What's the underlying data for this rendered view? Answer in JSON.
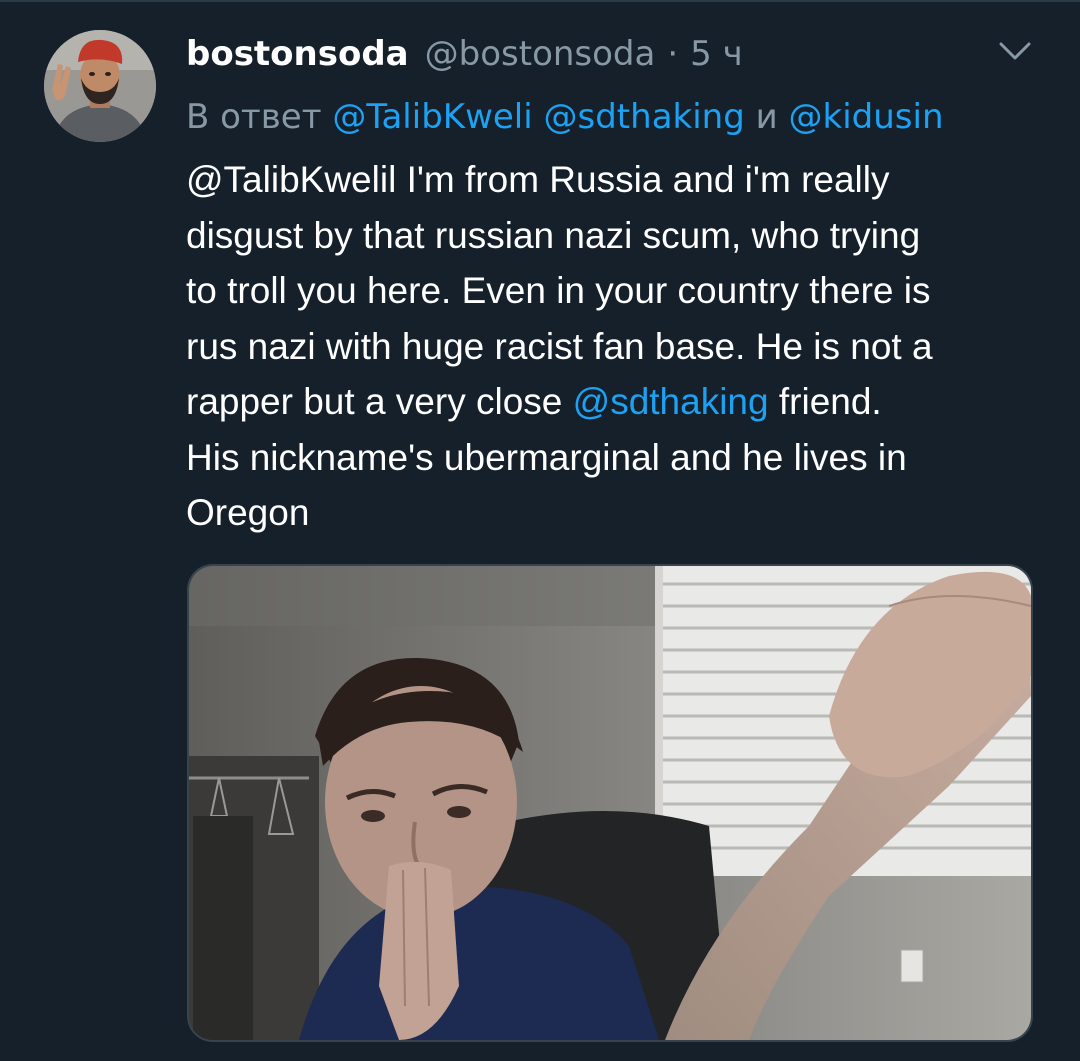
{
  "tweet": {
    "author": {
      "display_name": "bostonsoda",
      "handle": "@bostonsoda"
    },
    "separator": "·",
    "timestamp": "5 ч",
    "reply": {
      "prefix": "В ответ",
      "mention_1": "@TalibKweli",
      "mention_2": "@sdthaking",
      "conjunction": "и",
      "mention_3": "@kidusin"
    },
    "text": {
      "line_1": "@TalibKwelil I'm from Russia and i'm really",
      "line_2": "disgust by that russian nazi scum, who trying",
      "line_3": "to troll you here. Even in your country there is",
      "line_4": "rus nazi with huge racist fan base. He is not a",
      "line_5_before": "rapper but a very close ",
      "line_5_mention": "@sdthaking",
      "line_5_after": " friend.",
      "line_6": "His nickname's ubermarginal and he lives in",
      "line_7": "Oregon"
    }
  },
  "colors": {
    "background": "#15202b",
    "text_primary": "#ffffff",
    "text_secondary": "#8899a6",
    "link": "#1da1f2"
  },
  "icons": {
    "menu": "chevron-down-icon"
  }
}
